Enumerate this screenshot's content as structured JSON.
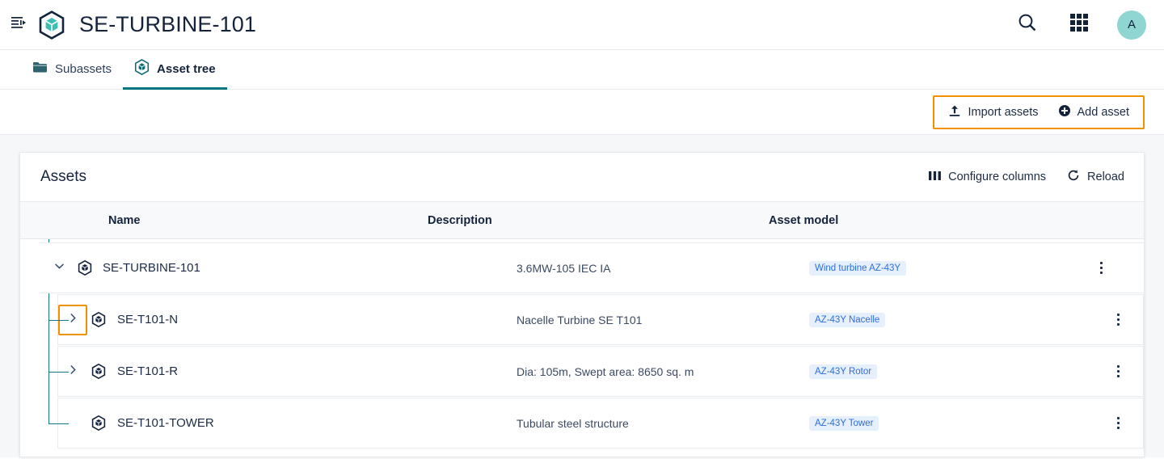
{
  "appbar": {
    "title": "SE-TURBINE-101",
    "sidebar_toggle_icon": "list-expand-icon",
    "brand_icon": "asset-cube-icon",
    "search_icon": "search-icon",
    "apps_icon": "grid-apps-icon",
    "avatar_initial": "A"
  },
  "tabs": [
    {
      "label": "Subassets",
      "icon": "folder-icon",
      "active": false
    },
    {
      "label": "Asset tree",
      "icon": "asset-cube-icon",
      "active": true
    }
  ],
  "actionbar": {
    "import_label": "Import assets",
    "import_icon": "upload-icon",
    "add_label": "Add asset",
    "add_icon": "plus-circle-icon",
    "focus_color": "#f29100"
  },
  "card": {
    "title": "Assets",
    "configure_columns_label": "Configure columns",
    "configure_columns_icon": "columns-icon",
    "reload_label": "Reload",
    "reload_icon": "refresh-icon"
  },
  "table": {
    "columns": [
      "Name",
      "Description",
      "Asset model"
    ],
    "rows": [
      {
        "name": "SE-TURBINE-101",
        "description": "3.6MW-105 IEC IA",
        "model": "Wind turbine AZ-43Y",
        "level": 0,
        "expanded": true,
        "has_children": true,
        "focused": false
      },
      {
        "name": "SE-T101-N",
        "description": "Nacelle Turbine SE T101",
        "model": "AZ-43Y Nacelle",
        "level": 1,
        "expanded": false,
        "has_children": true,
        "focused": true
      },
      {
        "name": "SE-T101-R",
        "description": "Dia: 105m, Swept area: 8650 sq. m",
        "model": "AZ-43Y Rotor",
        "level": 1,
        "expanded": false,
        "has_children": true,
        "focused": false
      },
      {
        "name": "SE-T101-TOWER",
        "description": "Tubular steel structure",
        "model": "AZ-43Y Tower",
        "level": 1,
        "expanded": false,
        "has_children": false,
        "focused": false
      }
    ]
  },
  "colors": {
    "brand_teal": "#3fbfb4",
    "accent_teal": "#00747f",
    "focus_orange": "#f29100",
    "badge_bg": "#e6effc",
    "badge_text": "#2d6fd6",
    "navy": "#14233c"
  }
}
